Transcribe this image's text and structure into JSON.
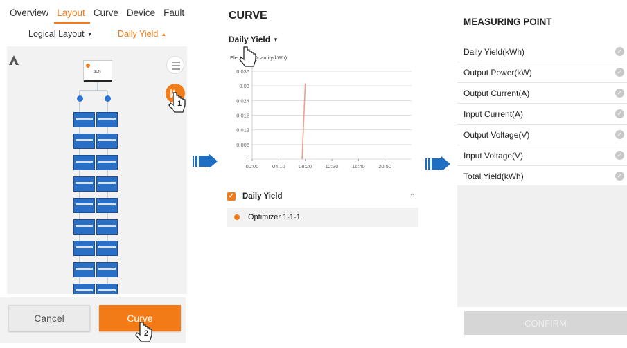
{
  "layout_screen": {
    "tabs": [
      {
        "label": "Overview",
        "active": false
      },
      {
        "label": "Layout",
        "active": true
      },
      {
        "label": "Curve",
        "active": false
      },
      {
        "label": "Device",
        "active": false
      },
      {
        "label": "Fault",
        "active": false
      }
    ],
    "left_dropdown": "Logical Layout",
    "right_dropdown": "Daily Yield",
    "device_label": "SUN",
    "cancel_label": "Cancel",
    "curve_label": "Curve",
    "step1": "1",
    "step2": "2"
  },
  "curve_screen": {
    "title": "CURVE",
    "selector": "Daily Yield",
    "y_axis_label": "Electricity Quantity(kWh)",
    "legend_header": "Daily Yield",
    "legend_item": "Optimizer 1-1-1"
  },
  "measuring_screen": {
    "title": "MEASURING POINT",
    "items": [
      "Daily Yield(kWh)",
      "Output Power(kW)",
      "Output Current(A)",
      "Input Current(A)",
      "Output Voltage(V)",
      "Input Voltage(V)",
      "Total Yield(kWh)"
    ],
    "confirm_label": "CONFIRM"
  },
  "colors": {
    "accent": "#f07c1a",
    "blue": "#2a6fc6",
    "arrow": "#1e6fc4"
  },
  "chart_data": {
    "type": "line",
    "title": "",
    "ylabel": "Electricity Quantity(kWh)",
    "xlabel": "",
    "x_ticks": [
      "00:00",
      "04:10",
      "08:20",
      "12:30",
      "16:40",
      "20:50"
    ],
    "y_ticks": [
      "0",
      "0.006",
      "0.012",
      "0.018",
      "0.024",
      "0.03",
      "0.036"
    ],
    "ylim": [
      0,
      0.036
    ],
    "series": [
      {
        "name": "Optimizer 1-1-1",
        "x": [
          "07:50",
          "08:20"
        ],
        "values": [
          0,
          0.031
        ]
      }
    ]
  }
}
